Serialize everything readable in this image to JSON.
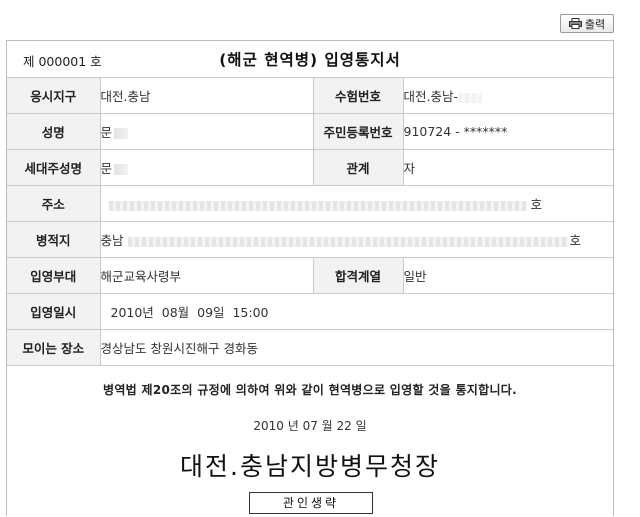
{
  "toolbar": {
    "print_label": "출력",
    "print_icon": "printer-icon"
  },
  "header": {
    "doc_number": "제 000001 호",
    "title": "(해군 현역병) 입영통지서"
  },
  "rows": {
    "r1": {
      "label_a": "응시지구",
      "value_a": "대전.충남",
      "label_b": "수험번호",
      "value_b": "대전.충남-"
    },
    "r2": {
      "label_a": "성명",
      "value_a": "문",
      "label_b": "주민등록번호",
      "value_b": "910724 - *******"
    },
    "r3": {
      "label_a": "세대주성명",
      "value_a": "문",
      "label_b": "관계",
      "value_b": "자"
    },
    "r4": {
      "label": "주소",
      "value": "호"
    },
    "r5": {
      "label": "병적지",
      "value": "충남",
      "value_tail": "호"
    },
    "r6": {
      "label_a": "입영부대",
      "value_a": "해군교육사령부",
      "label_b": "합격계열",
      "value_b": "일반"
    },
    "r7": {
      "label": "입영일시",
      "value": "2010년  08월  09일  15:00"
    },
    "r8": {
      "label": "모이는 장소",
      "value": "경상남도 창원시진해구 경화동"
    }
  },
  "notice": {
    "text": "병역법 제20조의 규정에 의하여 위와 같이 현역병으로 입영할 것을 통지합니다.",
    "date": "2010 년 07 월 22 일",
    "issuer": "대전.충남지방병무청장",
    "seal_label": "관인생략"
  }
}
